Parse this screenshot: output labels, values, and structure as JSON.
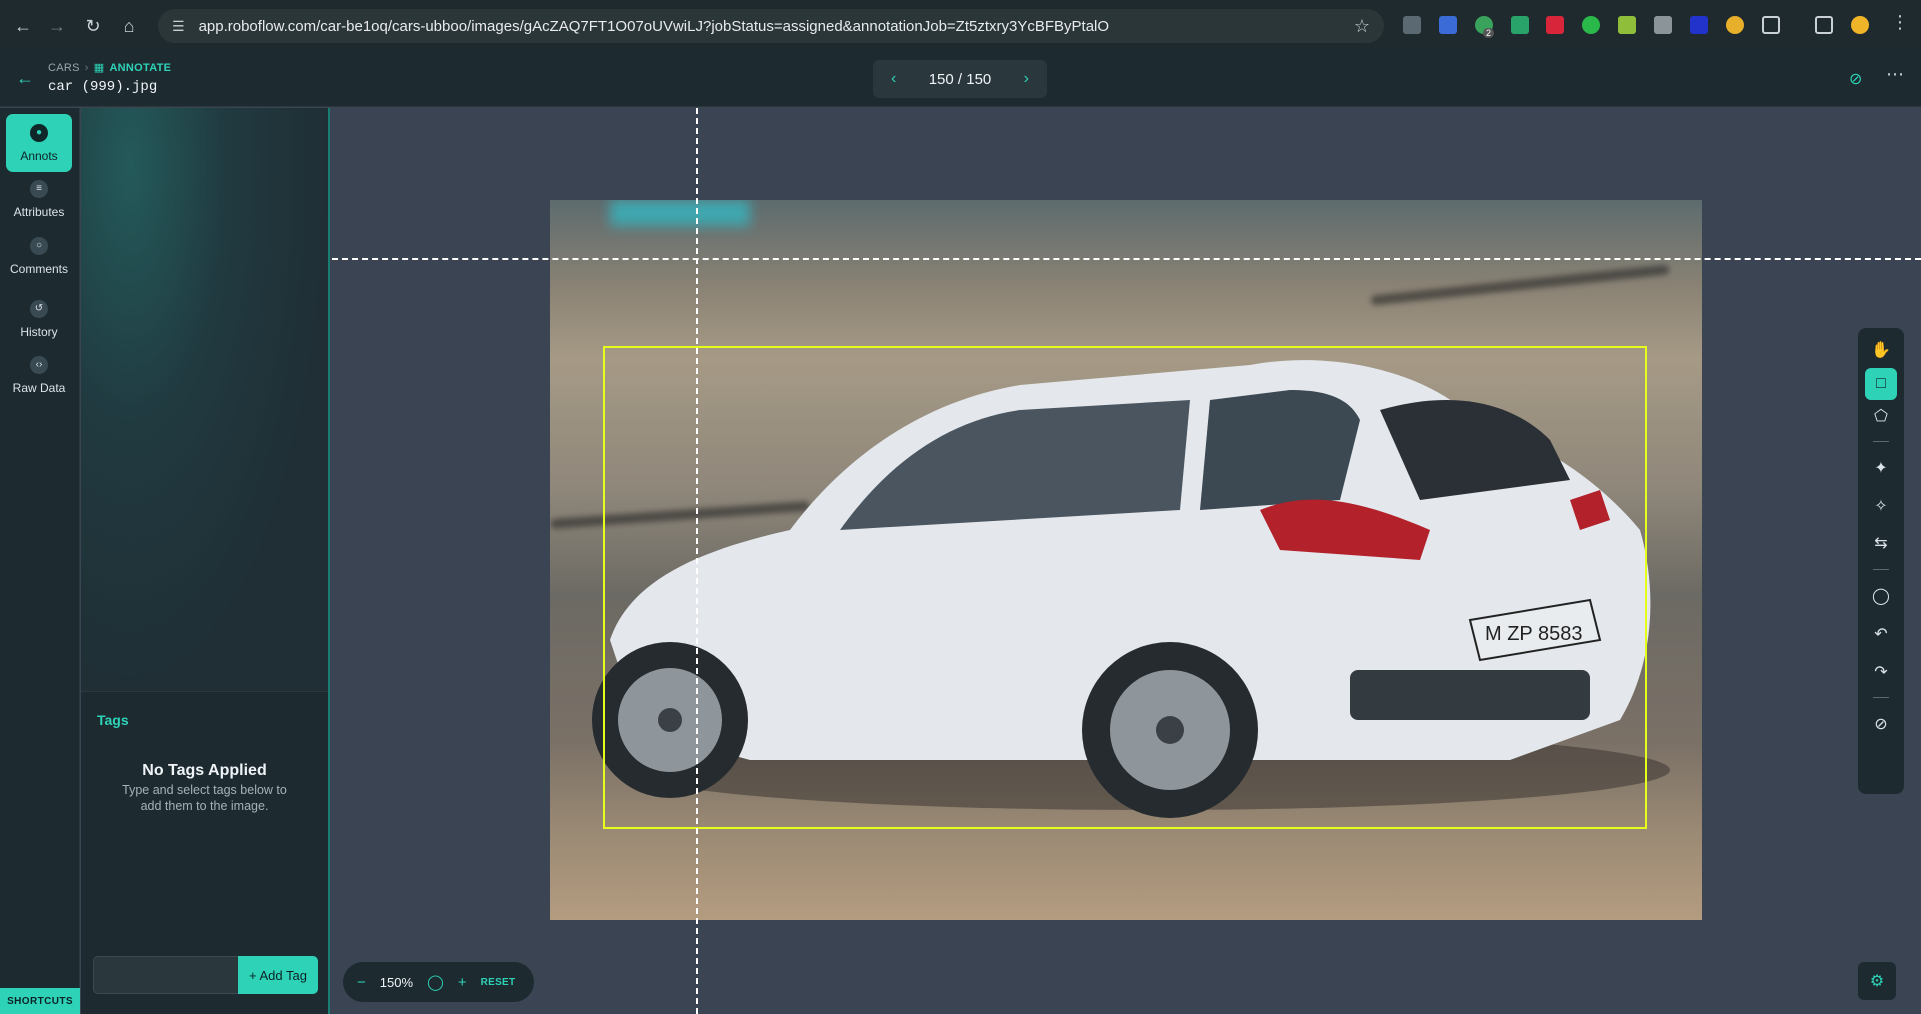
{
  "browser": {
    "url": "app.roboflow.com/car-be1oq/cars-ubboo/images/gAcZAQ7FT1O07oUVwiLJ?jobStatus=assigned&annotationJob=Zt5ztxry3YcBFByPtalO",
    "back_icon": "arrow-left-icon",
    "forward_icon": "arrow-right-icon",
    "reload_icon": "reload-icon",
    "home_icon": "home-icon",
    "extension_badge": "2"
  },
  "header": {
    "project": "CARS",
    "section": "ANNOTATE",
    "filename": "car (999).jpg",
    "pager": "150 / 150"
  },
  "rail": {
    "items": [
      {
        "label": "Annots",
        "icon": "annotations-icon"
      },
      {
        "label": "Attributes",
        "icon": "list-icon"
      },
      {
        "label": "Comments",
        "icon": "comment-icon"
      },
      {
        "label": "History",
        "icon": "history-icon"
      },
      {
        "label": "Raw Data",
        "icon": "code-icon"
      }
    ],
    "shortcuts": "SHORTCUTS"
  },
  "tags": {
    "title": "Tags",
    "empty_title": "No Tags Applied",
    "empty_hint": "Type and select tags below to add them to the image.",
    "input_value": "",
    "add_button": "+ Add Tag"
  },
  "zoom": {
    "value": "150%",
    "reset": "RESET"
  },
  "colors": {
    "accent": "#2ed3b7",
    "bbox": "#e6ff1a",
    "panel": "#1d2a30",
    "canvas": "#3b4452"
  },
  "tools": [
    "hand-icon",
    "bounding-box-icon",
    "polygon-icon",
    "smart-select-icon",
    "magic-wand-icon",
    "repeat-icon",
    "comment-icon",
    "undo-icon",
    "redo-icon",
    "hide-icon"
  ]
}
